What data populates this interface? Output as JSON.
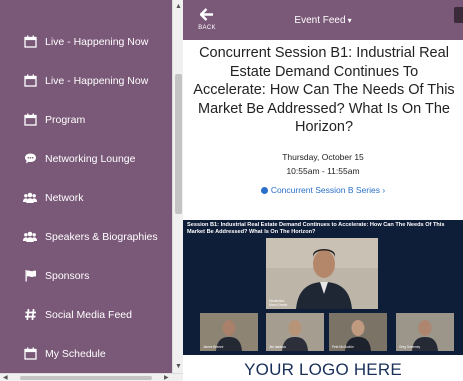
{
  "sidebar": {
    "items": [
      {
        "label": "Live - Happening Now",
        "icon": "calendar-icon"
      },
      {
        "label": "Live - Happening Now",
        "icon": "calendar-icon"
      },
      {
        "label": "Program",
        "icon": "calendar-icon"
      },
      {
        "label": "Networking Lounge",
        "icon": "chat-bubble-icon"
      },
      {
        "label": "Network",
        "icon": "people-icon"
      },
      {
        "label": "Speakers & Biographies",
        "icon": "people-icon"
      },
      {
        "label": "Sponsors",
        "icon": "flag-icon"
      },
      {
        "label": "Social Media Feed",
        "icon": "hashtag-icon"
      },
      {
        "label": "My Schedule",
        "icon": "calendar-icon"
      }
    ]
  },
  "header": {
    "back_label": "BACK",
    "feed_title": "Event Feed",
    "caret": "▾"
  },
  "session": {
    "title": "Concurrent Session B1: Industrial Real Estate Demand Continues To Accelerate: How Can The Needs Of This Market Be Addressed? What Is On The Horizon?",
    "date": "Thursday, October 15",
    "time": "10:55am - 11:55am",
    "series_link": "Concurrent Session B Series",
    "series_link_arrow": "›"
  },
  "video": {
    "title": "Session B1: Industrial Real Estate Demand Continues to Accelerate: How Can The Needs Of This Market Be Addressed? What Is On The Horizon?",
    "main_speaker_caption": "Moderator\nMarc Krantz",
    "speakers": [
      "James Breeze",
      "Jim Iadakos",
      "Pete McGuckin",
      "Greg Sweeney"
    ]
  },
  "logo": {
    "text": "YOUR LOGO HERE"
  },
  "colors": {
    "sidebar_bg": "#7a5878",
    "link": "#2a6fc9",
    "video_bg": "#0f1e38",
    "logo_text": "#1a2f5a"
  }
}
